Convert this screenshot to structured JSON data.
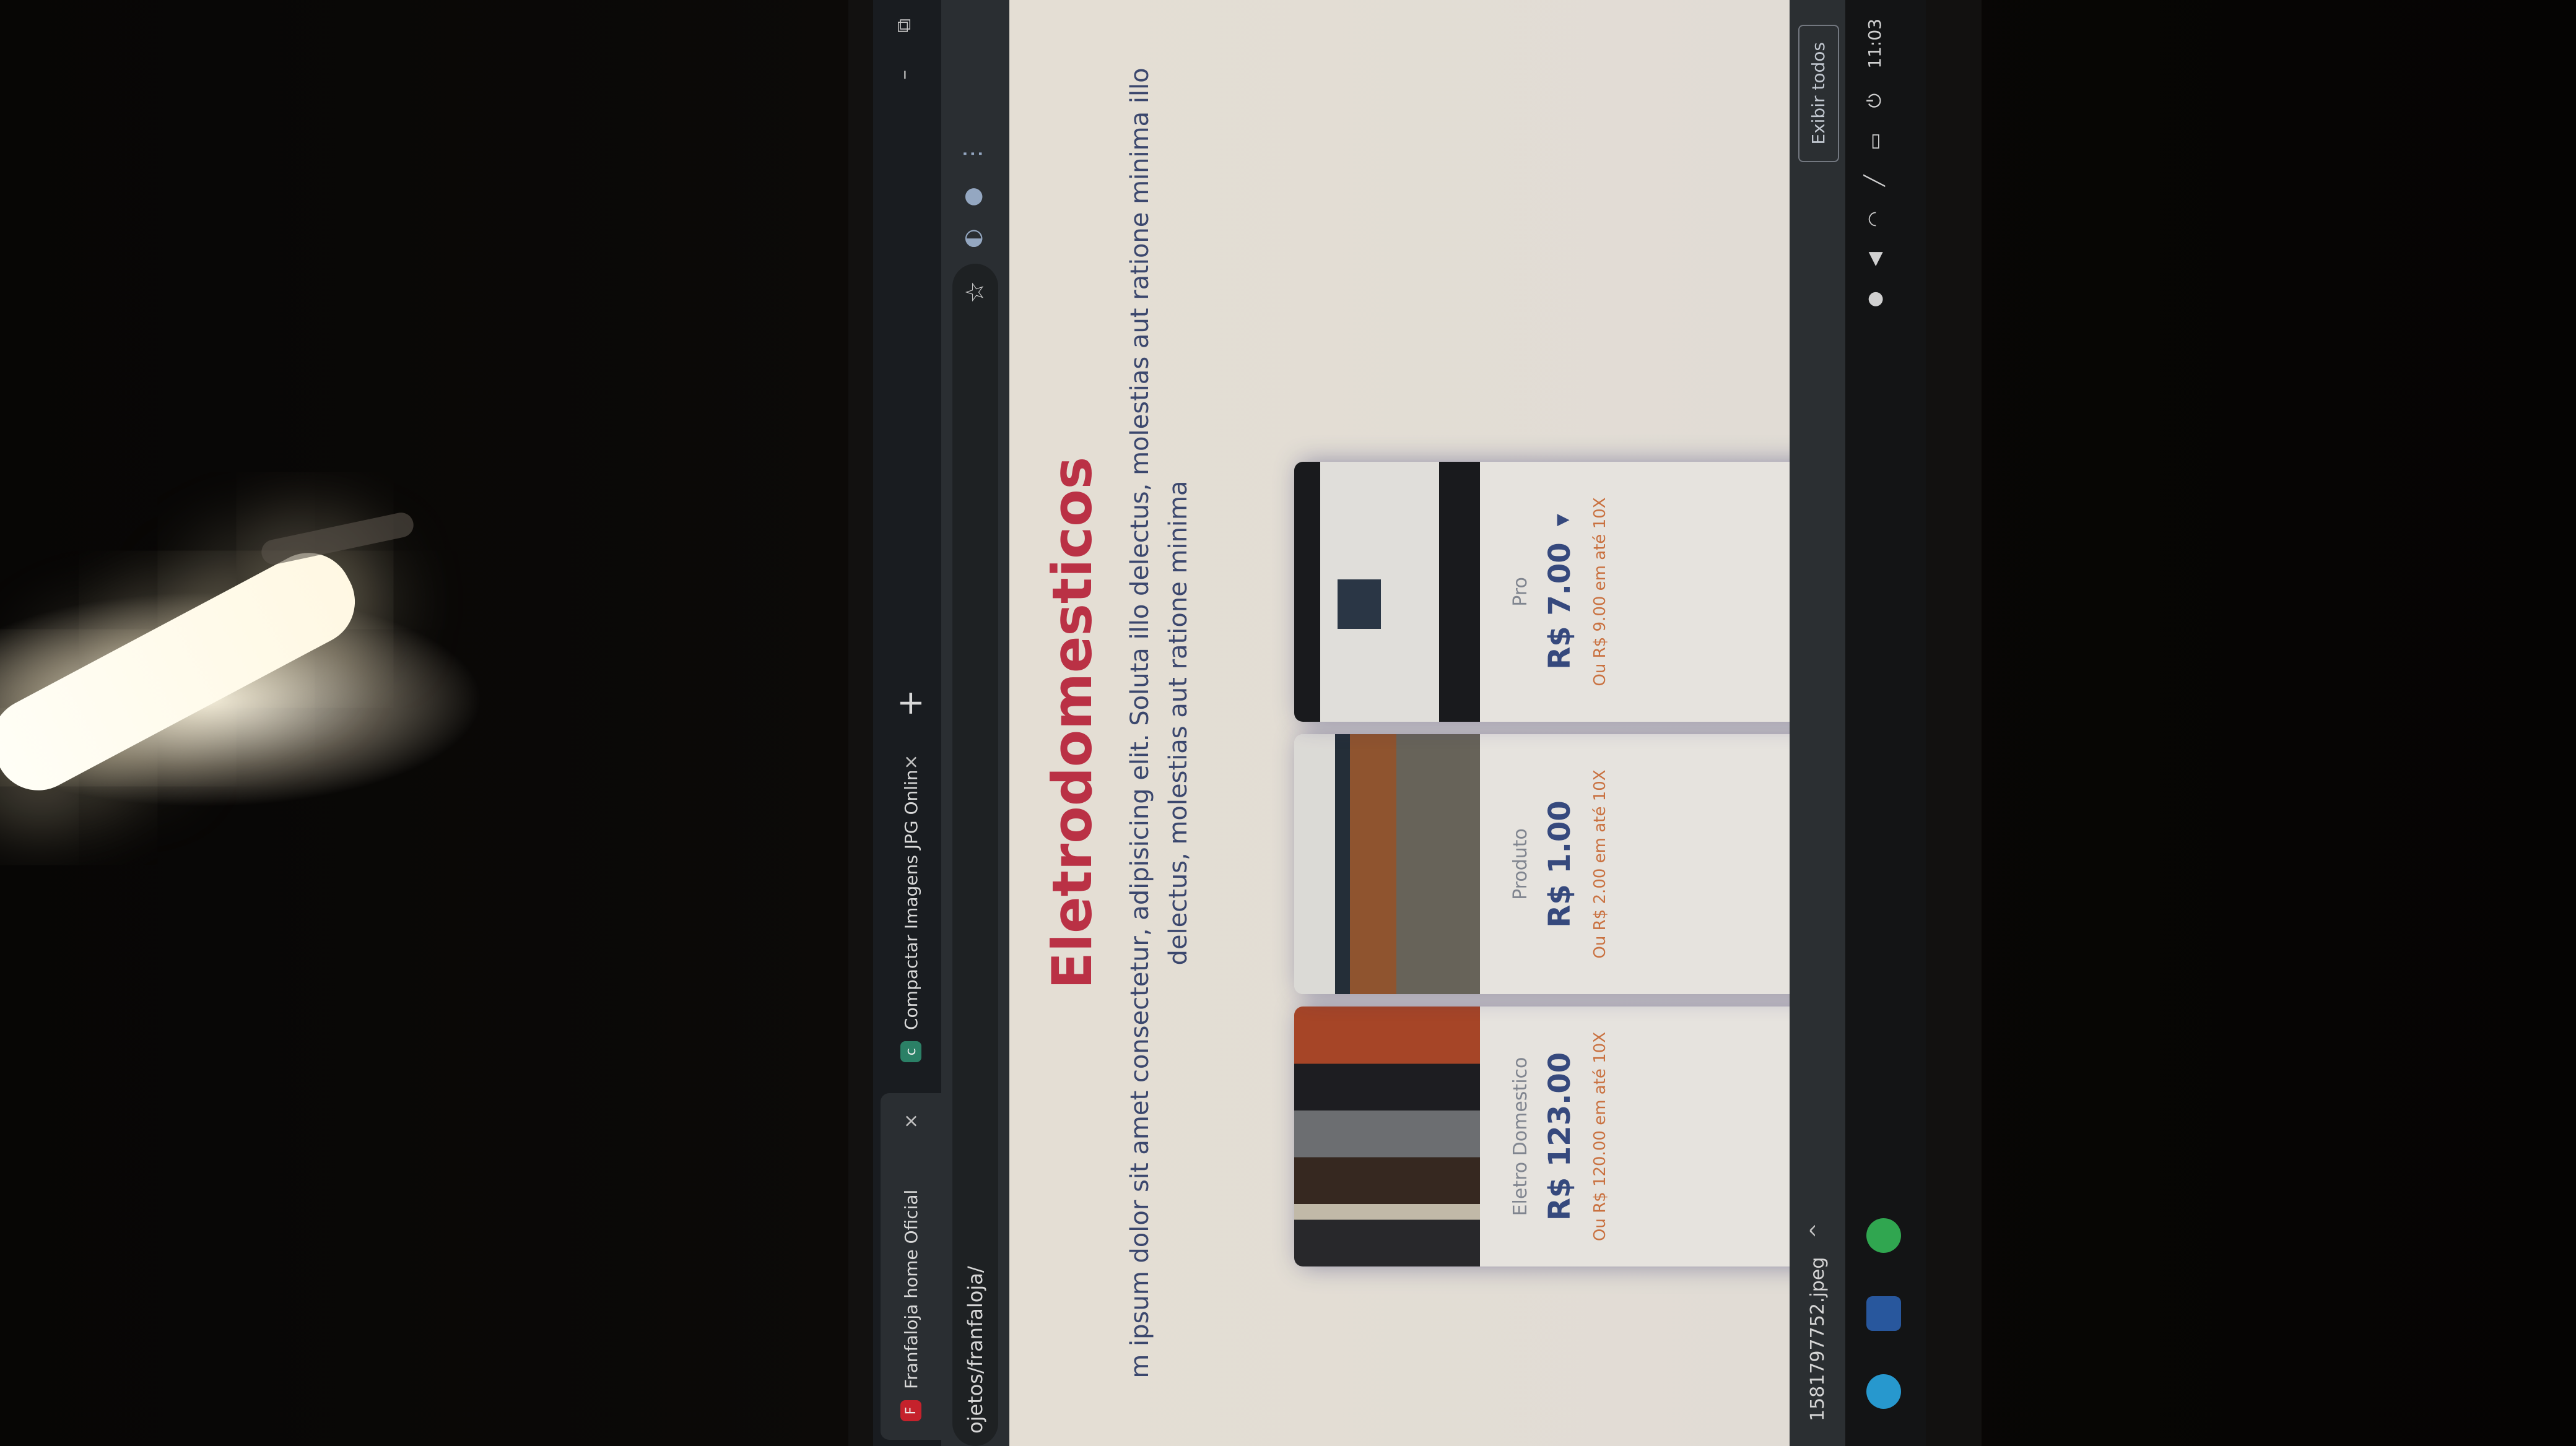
{
  "browser": {
    "tabs": [
      {
        "label": "Franfaloja home Oficial",
        "favicon": "F",
        "close": "×"
      },
      {
        "label": "Compactar Imagens JPG Online",
        "favicon": "c",
        "close": "×"
      }
    ],
    "new_tab": "+",
    "window_controls": {
      "minimize": "–",
      "maximize": "⧉"
    },
    "address": "ojetos/franfaloja/",
    "bookmark_star": "☆",
    "toolbar_icons": [
      "extensions-icon",
      "profile-icon",
      "menu-icon"
    ]
  },
  "section": {
    "title": "Eletrodomesticos",
    "description_line_1": "m ipsum dolor sit amet consectetur, adipisicing elit. Soluta illo delectus, molestias aut ratione minima illo",
    "description_line_2": "delectus, molestias aut ratione minima"
  },
  "products": [
    {
      "name": "Eletro Domestico",
      "price": "R$ 123.00",
      "installment": "Ou R$ 120.00 em até 10X"
    },
    {
      "name": "Produto",
      "price": "R$ 1.00",
      "installment": "Ou R$ 2.00 em até 10X"
    },
    {
      "name": "Pro",
      "price": "R$ 7.00",
      "installment": "Ou R$ 9.00 em até 10X",
      "cart_icon": "cart-icon"
    }
  ],
  "download_bar": {
    "file": "1581797752.jpeg",
    "chevron": "^",
    "show_all": "Exibir todos"
  },
  "taskbar": {
    "pins": [
      "telegram-icon",
      "editor-icon",
      "whatsapp-icon"
    ],
    "tray_icons": [
      "power-icon",
      "keyboard-icon",
      "pen-icon",
      "wifi-icon",
      "volume-icon",
      "info-icon"
    ],
    "time": "11:03"
  },
  "colors": {
    "title": "#c8354a",
    "price": "#3a4e86",
    "installment": "#d87a45"
  }
}
